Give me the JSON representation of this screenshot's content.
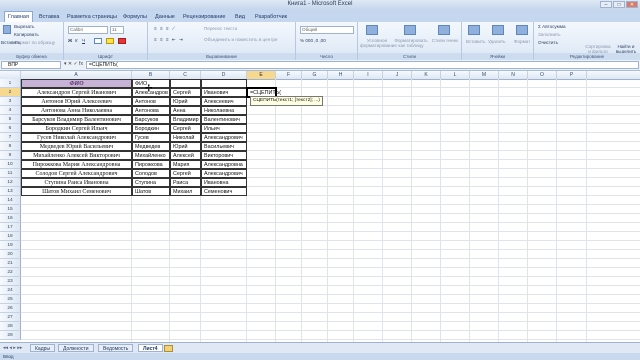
{
  "window": {
    "title": "Книга1 - Microsoft Excel"
  },
  "ribbon_tabs": [
    "Главная",
    "Вставка",
    "Разметка страницы",
    "Формулы",
    "Данные",
    "Рецензирование",
    "Вид",
    "Разработчик"
  ],
  "clipboard": {
    "cut": "Вырезать",
    "copy": "Копировать",
    "format": "Формат по образцу",
    "paste": "Вставить",
    "label": "Буфер обмена"
  },
  "font": {
    "name": "Calibri",
    "size": "11",
    "label": "Шрифт"
  },
  "alignment": {
    "wrap": "Перенос текста",
    "merge": "Объединить и поместить в центре",
    "label": "Выравнивание"
  },
  "number": {
    "format": "Общий",
    "label": "Число"
  },
  "styles": {
    "cond": "Условное форматирование",
    "table": "Форматировать как таблицу",
    "cell": "Стили ячеек",
    "label": "Стили"
  },
  "cells": {
    "insert": "Вставить",
    "delete": "Удалить",
    "format": "Формат",
    "label": "Ячейки"
  },
  "editing": {
    "autosum": "Автосумма",
    "fill": "Заполнить",
    "clear": "Очистить",
    "sort": "Сортировка и фильтр",
    "find": "Найти и выделить",
    "label": "Редактирование"
  },
  "formula_bar": {
    "name_box": "ВПР",
    "buttons": "▾  ✕ ✓ fx",
    "formula": "=СЦЕПИТЬ("
  },
  "columns": [
    "A",
    "B",
    "C",
    "D",
    "E",
    "F",
    "G",
    "H",
    "I",
    "J",
    "K",
    "L",
    "M",
    "N",
    "O",
    "P"
  ],
  "rows": [
    "1",
    "2",
    "3",
    "4",
    "5",
    "6",
    "7",
    "8",
    "9",
    "10",
    "11",
    "12",
    "13",
    "14",
    "15",
    "16",
    "17",
    "18",
    "19",
    "20",
    "21",
    "22",
    "23",
    "24",
    "25",
    "26",
    "27",
    "28",
    "29"
  ],
  "table": {
    "header_a": "ФИО",
    "header_b": "ФИО",
    "full_names": [
      "Александров Сергей Иванович",
      "Антонов Юрий Алексеевич",
      "Антонова Анна Николаевна",
      "Барсуков Владимир Валентинович",
      "Бородкин Сергей Ильич",
      "Гусев Николай Александрович",
      "Медведев Юрий Васильевич",
      "Михайленко Алексей Викторович",
      "Пирожкова Мария Александровна",
      "Солодов Сергей Александрович",
      "Ступина Раиса Ивановна",
      "Шатов Михаил Семенович"
    ],
    "surnames": [
      "Александров",
      "Антонов",
      "Антонова",
      "Барсуков",
      "Бородкин",
      "Гусев",
      "Медведев",
      "Михайленко",
      "Пирожкова",
      "Солодов",
      "Ступина",
      "Шатов"
    ],
    "names": [
      "Сергей",
      "Юрий",
      "Анна",
      "Владимир",
      "Сергей",
      "Николай",
      "Юрий",
      "Алексей",
      "Мария",
      "Сергей",
      "Раиса",
      "Михаил"
    ],
    "patronymics": [
      "Иванович",
      "Алексеевич",
      "Николаевна",
      "Валентинович",
      "Ильич",
      "Александрович",
      "Васильевич",
      "Викторович",
      "Александровна",
      "Александрович",
      "Ивановна",
      "Семенович"
    ]
  },
  "active_cell": {
    "text": "=СЦЕПИТЬ("
  },
  "tooltip": "СЦЕПИТЬ(текст1; [текст2]; ...)",
  "sheet_tabs": [
    "Кадры",
    "Должности",
    "Ведомость",
    "Лист4"
  ],
  "active_sheet": "Лист4",
  "status": "Ввод"
}
